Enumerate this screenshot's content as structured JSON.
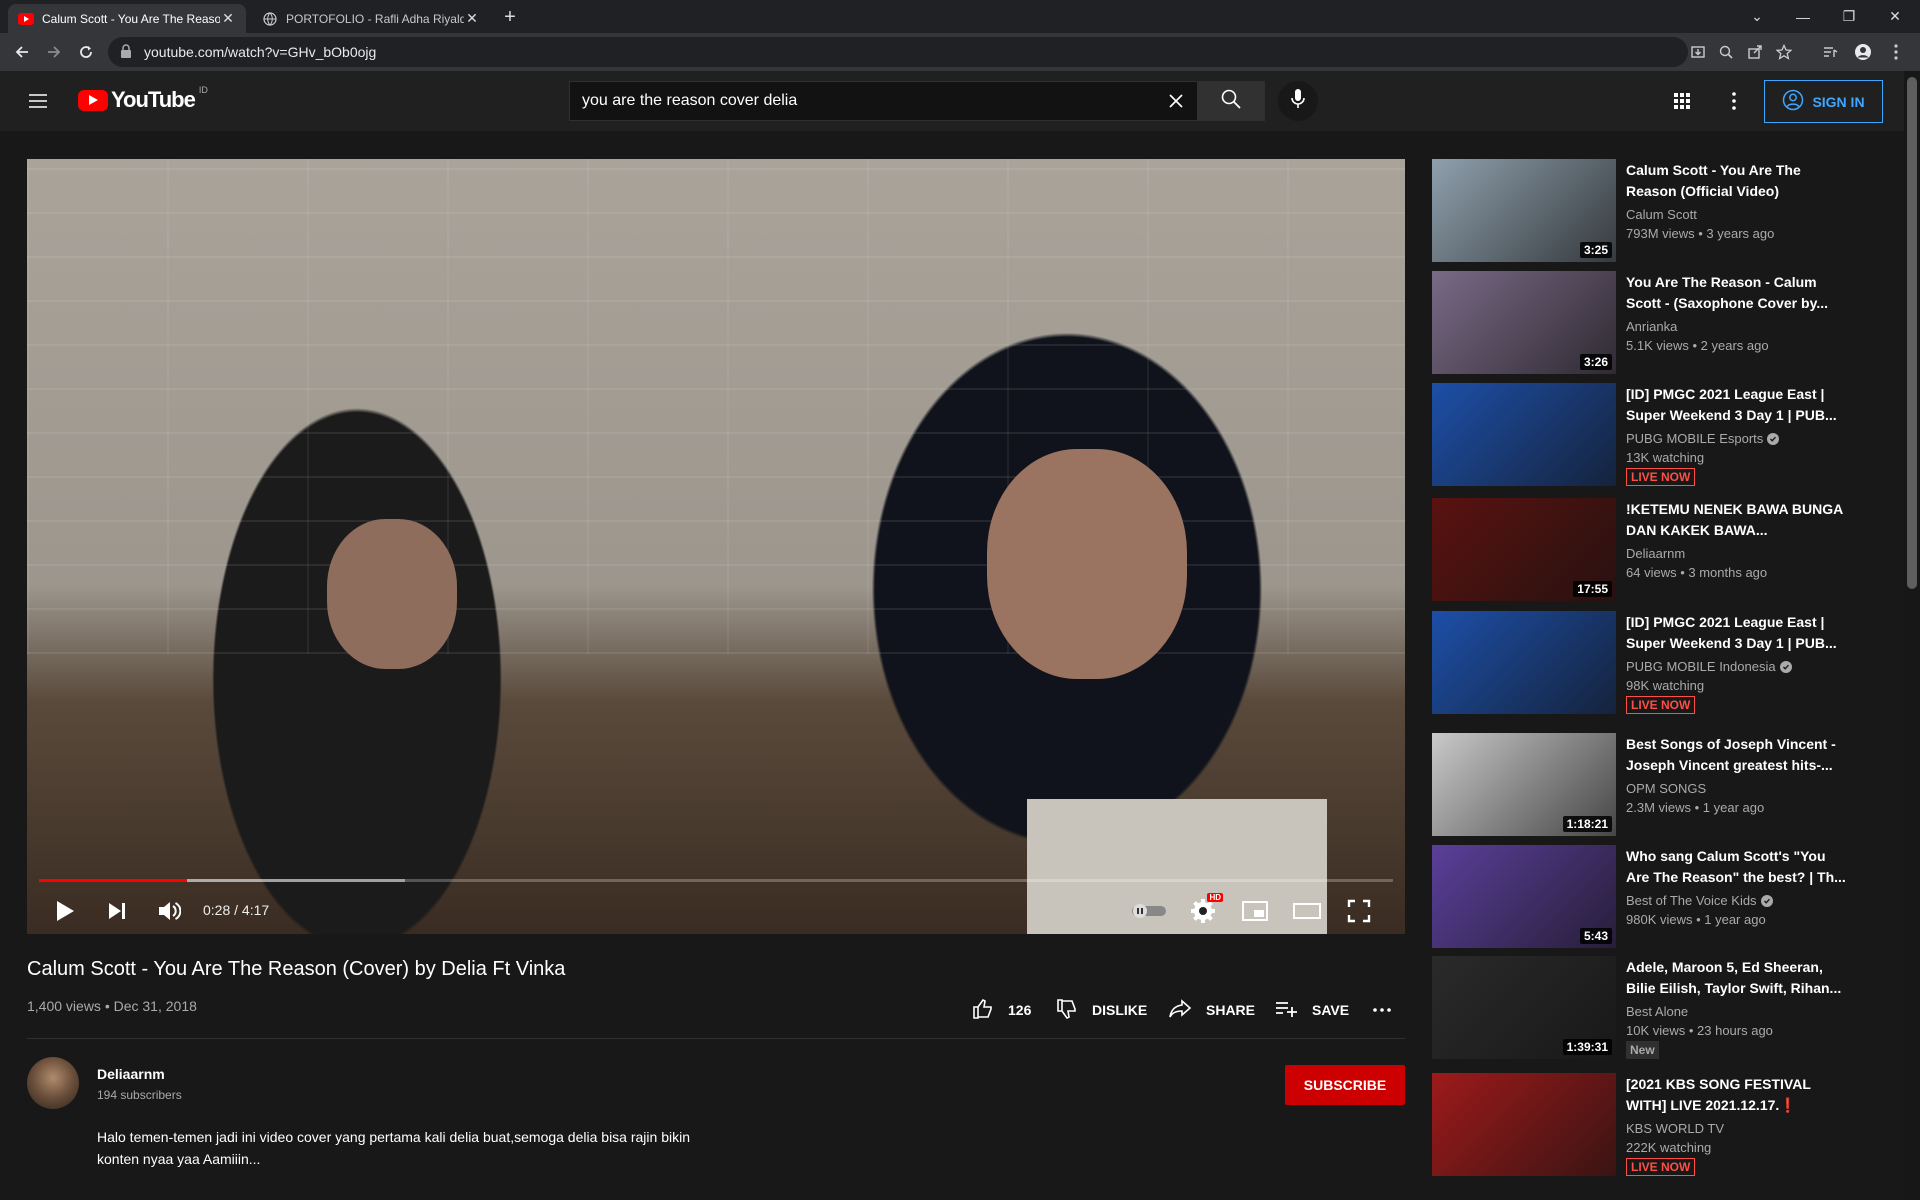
{
  "browser": {
    "tabs": [
      {
        "title": "Calum Scott - You Are The Reason (Cover) by Delia Ft Vinka - YouTube",
        "active": true
      },
      {
        "title": "PORTOFOLIO - Rafli Adha Riyaldy",
        "active": false
      }
    ],
    "url": "youtube.com/watch?v=GHv_bOb0ojg"
  },
  "youtube": {
    "logo_text": "YouTube",
    "region": "ID",
    "search_query": "you are the reason cover delia",
    "sign_in": "SIGN IN"
  },
  "player": {
    "time": "0:28 / 4:17",
    "played_fraction": 0.109,
    "buffered_fraction": 0.27,
    "quality_badge": "HD"
  },
  "video": {
    "title": "Calum Scott - You Are The Reason (Cover) by Delia Ft Vinka",
    "views_date": "1,400 views • Dec 31, 2018",
    "likes": "126",
    "dislike": "DISLIKE",
    "share": "SHARE",
    "save": "SAVE",
    "channel": "Deliaarnm",
    "subscribers": "194 subscribers",
    "subscribe": "SUBSCRIBE",
    "description_line1": "Halo temen-temen jadi ini video cover yang pertama kali delia buat,semoga delia bisa rajin bikin",
    "description_line2": "konten nyaa yaa Aamiiin..."
  },
  "related": [
    {
      "title": "Calum Scott - You Are The Reason (Official Video)",
      "channel": "Calum Scott",
      "meta": "793M views • 3 years ago",
      "duration": "3:25",
      "thumb_color": "#8fa0ad"
    },
    {
      "title": "You Are The Reason - Calum Scott - (Saxophone Cover by...",
      "channel": "Anrianka",
      "meta": "5.1K views • 2 years ago",
      "duration": "3:26",
      "thumb_color": "#7a6a86"
    },
    {
      "title": "[ID] PMGC 2021 League East | Super Weekend 3 Day 1 | PUB...",
      "channel": "PUBG MOBILE Esports",
      "meta": "13K watching",
      "badge": "LIVE NOW",
      "thumb_color": "#1d4fa8"
    },
    {
      "title": "!KETEMU NENEK BAWA BUNGA DAN KAKEK BAWA...",
      "channel": "Deliaarnm",
      "meta": "64 views • 3 months ago",
      "duration": "17:55",
      "thumb_color": "#5a1210"
    },
    {
      "title": "[ID] PMGC 2021 League East | Super Weekend 3 Day 1 | PUB...",
      "channel": "PUBG MOBILE Indonesia",
      "meta": "98K watching",
      "badge": "LIVE NOW",
      "thumb_color": "#1d4fa8"
    },
    {
      "title": "Best Songs of Joseph Vincent - Joseph Vincent greatest hits-...",
      "channel": "OPM SONGS",
      "meta": "2.3M views • 1 year ago",
      "duration": "1:18:21",
      "thumb_color": "#c9c9c9"
    },
    {
      "title": "Who sang Calum Scott's \"You Are The Reason\" the best? | Th...",
      "channel": "Best of The Voice Kids",
      "meta": "980K views • 1 year ago",
      "duration": "5:43",
      "thumb_color": "#5b3f9a"
    },
    {
      "title": "Adele, Maroon 5, Ed Sheeran, Bilie Eilish, Taylor Swift, Rihan...",
      "channel": "Best Alone",
      "meta": "10K views • 23 hours ago",
      "duration": "1:39:31",
      "badge2": "New",
      "thumb_color": "#2a2a2a"
    },
    {
      "title": "[2021 KBS SONG FESTIVAL WITH] LIVE 2021.12.17.❗",
      "channel": "KBS WORLD TV",
      "meta": "222K watching",
      "badge": "LIVE NOW",
      "thumb_color": "#9e1a1a"
    }
  ]
}
